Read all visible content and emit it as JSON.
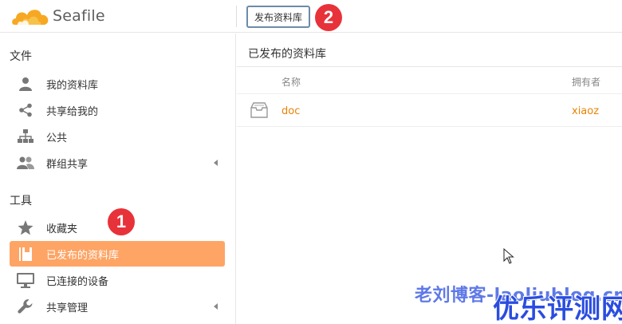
{
  "app": {
    "logo_text": "Seafile"
  },
  "header": {
    "publish_button": "发布资料库",
    "callout_2": "2"
  },
  "sidebar": {
    "files_title": "文件",
    "files_items": [
      {
        "label": "我的资料库",
        "icon": "user-icon"
      },
      {
        "label": "共享给我的",
        "icon": "share-icon"
      },
      {
        "label": "公共",
        "icon": "org-tree-icon"
      },
      {
        "label": "群组共享",
        "icon": "group-icon"
      }
    ],
    "tools_title": "工具",
    "tools_items": [
      {
        "label": "收藏夹",
        "icon": "star-icon"
      },
      {
        "label": "已发布的资料库",
        "icon": "book-icon",
        "active": true
      },
      {
        "label": "已连接的设备",
        "icon": "monitor-icon"
      },
      {
        "label": "共享管理",
        "icon": "wrench-icon"
      }
    ],
    "callout_1": "1"
  },
  "main": {
    "title": "已发布的资料库",
    "columns": {
      "name": "名称",
      "owner": "拥有者"
    },
    "rows": [
      {
        "name": "doc",
        "owner": "xiaoz",
        "icon": "repo-icon"
      }
    ]
  },
  "watermark": {
    "line1": "老刘博客-laoliublog.cn",
    "line2": "优乐评测网"
  },
  "colors": {
    "accent": "#fea465",
    "link": "#eb8205",
    "callout": "#e8323a",
    "watermark": "#2a4de0"
  }
}
